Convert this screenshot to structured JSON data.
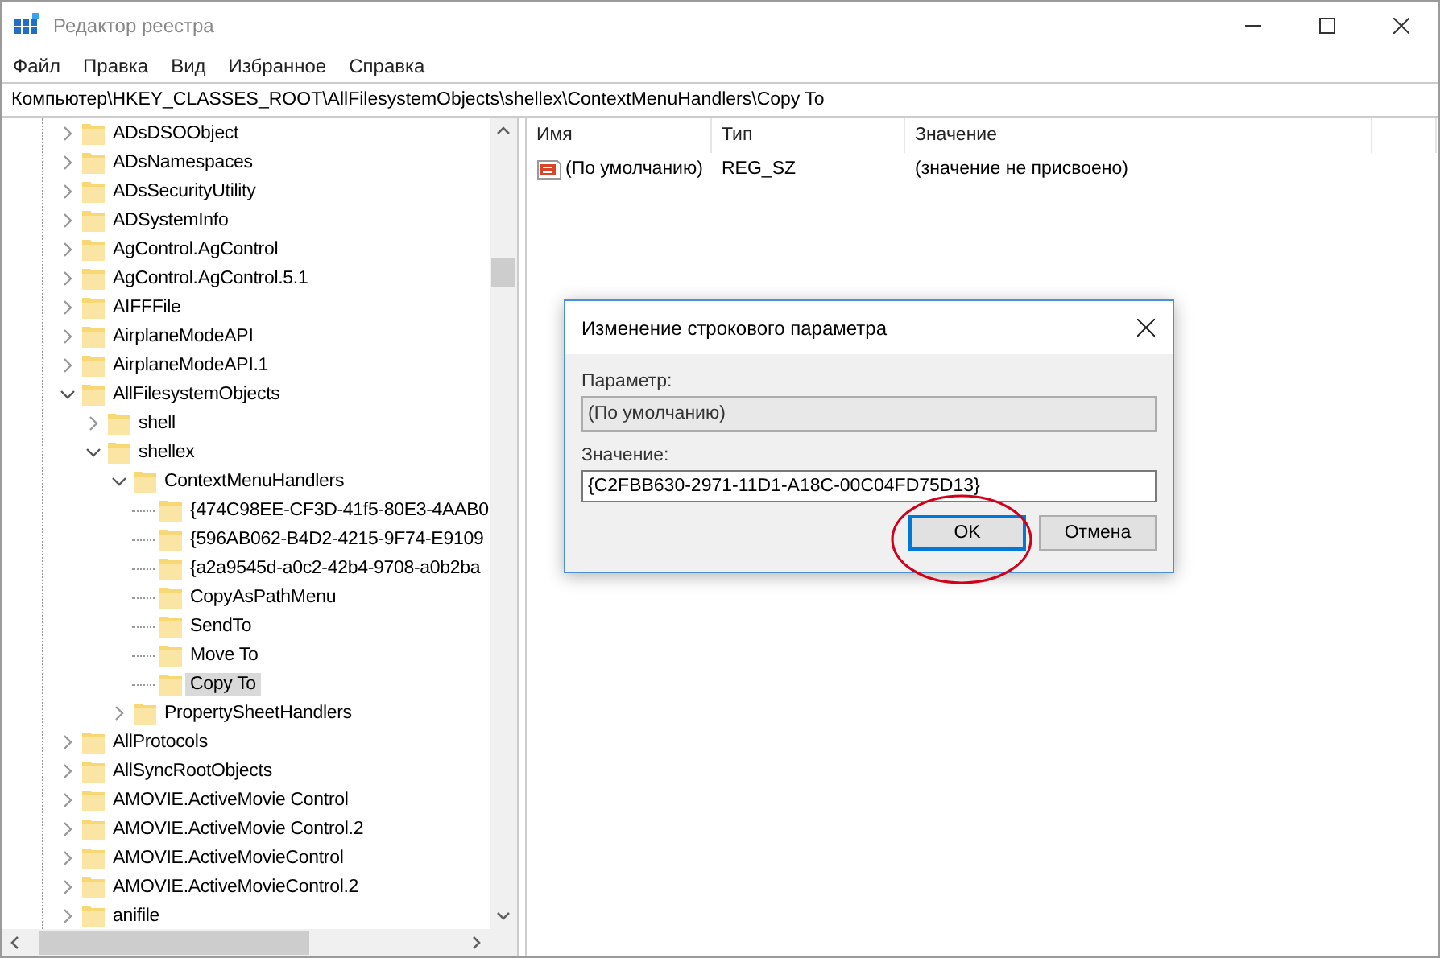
{
  "window": {
    "title": "Редактор реестра"
  },
  "menu": [
    "Файл",
    "Правка",
    "Вид",
    "Избранное",
    "Справка"
  ],
  "address_bar": {
    "value": "Компьютер\\HKEY_CLASSES_ROOT\\AllFilesystemObjects\\shellex\\ContextMenuHandlers\\Copy To"
  },
  "tree": {
    "items": [
      {
        "label": "ADsDSOObject",
        "kind": "branch",
        "expanded": false,
        "selected": false
      },
      {
        "label": "ADsNamespaces",
        "kind": "branch",
        "expanded": false,
        "selected": false
      },
      {
        "label": "ADsSecurityUtility",
        "kind": "branch",
        "expanded": false,
        "selected": false
      },
      {
        "label": "ADSystemInfo",
        "kind": "branch",
        "expanded": false,
        "selected": false
      },
      {
        "label": "AgControl.AgControl",
        "kind": "branch",
        "expanded": false,
        "selected": false
      },
      {
        "label": "AgControl.AgControl.5.1",
        "kind": "branch",
        "expanded": false,
        "selected": false
      },
      {
        "label": "AIFFFile",
        "kind": "branch",
        "expanded": false,
        "selected": false
      },
      {
        "label": "AirplaneModeAPI",
        "kind": "branch",
        "expanded": false,
        "selected": false
      },
      {
        "label": "AirplaneModeAPI.1",
        "kind": "branch",
        "expanded": false,
        "selected": false
      },
      {
        "label": "AllFilesystemObjects",
        "kind": "branch",
        "expanded": true,
        "selected": false,
        "children": [
          {
            "label": "shell",
            "kind": "branch",
            "expanded": false,
            "selected": false
          },
          {
            "label": "shellex",
            "kind": "branch",
            "expanded": true,
            "selected": false,
            "children": [
              {
                "label": "ContextMenuHandlers",
                "kind": "branch",
                "expanded": true,
                "selected": false,
                "children": [
                  {
                    "label": "{474C98EE-CF3D-41f5-80E3-4AAB0",
                    "kind": "leaf",
                    "selected": false
                  },
                  {
                    "label": "{596AB062-B4D2-4215-9F74-E9109",
                    "kind": "leaf",
                    "selected": false
                  },
                  {
                    "label": "{a2a9545d-a0c2-42b4-9708-a0b2ba",
                    "kind": "leaf",
                    "selected": false
                  },
                  {
                    "label": "CopyAsPathMenu",
                    "kind": "leaf",
                    "selected": false
                  },
                  {
                    "label": "SendTo",
                    "kind": "leaf",
                    "selected": false
                  },
                  {
                    "label": "Move To",
                    "kind": "leaf",
                    "selected": false
                  },
                  {
                    "label": "Copy To",
                    "kind": "leaf",
                    "selected": true
                  }
                ]
              },
              {
                "label": "PropertySheetHandlers",
                "kind": "branch",
                "expanded": false,
                "selected": false
              }
            ]
          }
        ]
      },
      {
        "label": "AllProtocols",
        "kind": "branch",
        "expanded": false,
        "selected": false
      },
      {
        "label": "AllSyncRootObjects",
        "kind": "branch",
        "expanded": false,
        "selected": false
      },
      {
        "label": "AMOVIE.ActiveMovie Control",
        "kind": "branch",
        "expanded": false,
        "selected": false
      },
      {
        "label": "AMOVIE.ActiveMovie Control.2",
        "kind": "branch",
        "expanded": false,
        "selected": false
      },
      {
        "label": "AMOVIE.ActiveMovieControl",
        "kind": "branch",
        "expanded": false,
        "selected": false
      },
      {
        "label": "AMOVIE.ActiveMovieControl.2",
        "kind": "branch",
        "expanded": false,
        "selected": false
      },
      {
        "label": "anifile",
        "kind": "branch",
        "expanded": false,
        "selected": false
      }
    ]
  },
  "values_list": {
    "columns": [
      "Имя",
      "Тип",
      "Значение"
    ],
    "rows": [
      {
        "name": "(По умолчанию)",
        "type": "REG_SZ",
        "data": "(значение не присвоено)"
      }
    ]
  },
  "dialog": {
    "title": "Изменение строкового параметра",
    "parameter_label": "Параметр:",
    "parameter_value": "(По умолчанию)",
    "value_label": "Значение:",
    "value": "{C2FBB630-2971-11D1-A18C-00C04FD75D13}",
    "buttons": [
      {
        "label": "OK",
        "focused": true
      },
      {
        "label": "Отмена",
        "focused": false
      }
    ]
  },
  "annotation": {
    "kind": "ellipse"
  }
}
